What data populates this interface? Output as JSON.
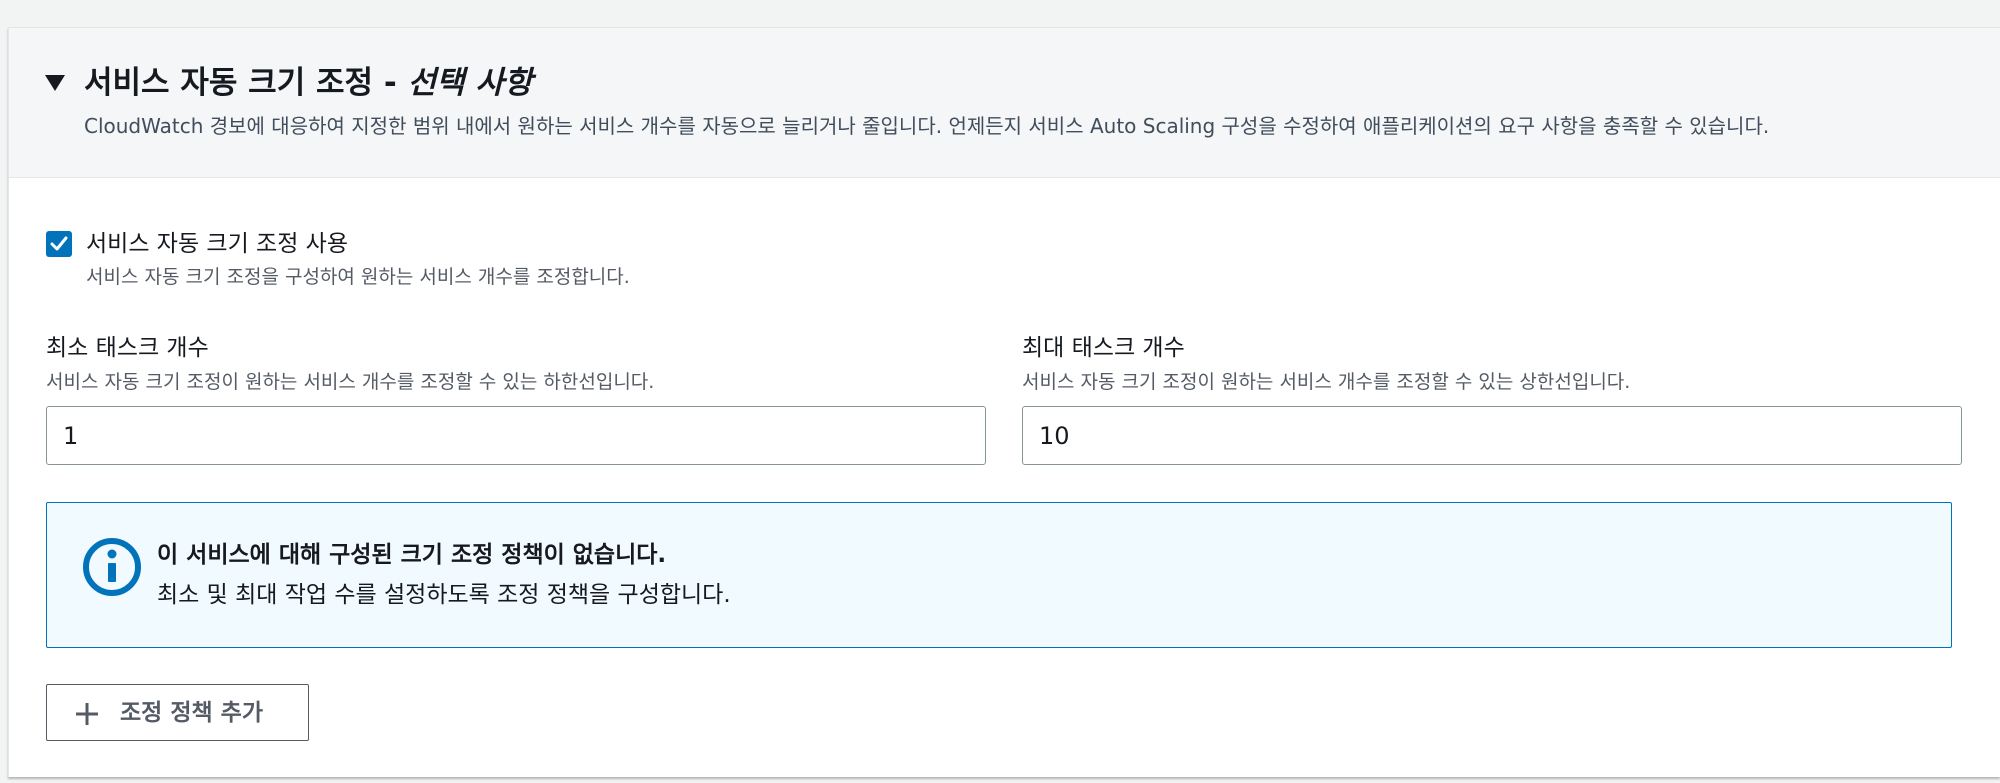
{
  "section": {
    "title_main": "서비스 자동 크기 조정 - ",
    "title_optional": "선택 사항",
    "description": "CloudWatch 경보에 대응하여 지정한 범위 내에서 원하는 서비스 개수를 자동으로 늘리거나 줄입니다. 언제든지 서비스 Auto Scaling 구성을 수정하여 애플리케이션의 요구 사항을 충족할 수 있습니다.",
    "expanded": true
  },
  "autoscaling_checkbox": {
    "label": "서비스 자동 크기 조정 사용",
    "description": "서비스 자동 크기 조정을 구성하여 원하는 서비스 개수를 조정합니다.",
    "checked": true
  },
  "min_tasks": {
    "label": "최소 태스크 개수",
    "description": "서비스 자동 크기 조정이 원하는 서비스 개수를 조정할 수 있는 하한선입니다.",
    "value": "1"
  },
  "max_tasks": {
    "label": "최대 태스크 개수",
    "description": "서비스 자동 크기 조정이 원하는 서비스 개수를 조정할 수 있는 상한선입니다.",
    "value": "10"
  },
  "info_alert": {
    "icon": "info-icon",
    "title": "이 서비스에 대해 구성된 크기 조정 정책이 없습니다.",
    "description": "최소 및 최대 작업 수를 설정하도록 조정 정책을 구성합니다."
  },
  "add_policy_button": {
    "icon": "plus-icon",
    "label": "조정 정책 추가"
  },
  "colors": {
    "accent": "#0073bb",
    "info_bg": "#f1faff",
    "text_primary": "#16191f",
    "text_secondary": "#545b64"
  }
}
